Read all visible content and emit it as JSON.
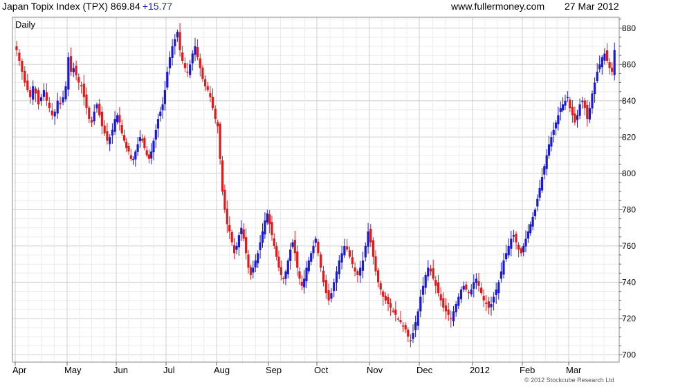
{
  "header": {
    "title": "Japan Topix Index (TPX) 869.84",
    "change": "+15.77",
    "site": "www.fullermoney.com",
    "date": "27 Mar 2012"
  },
  "footer": {
    "copyright": "© 2012 Stockcube Research Ltd"
  },
  "colors": {
    "up": "#1a1ad6",
    "down": "#e01a1a",
    "grid": "#d0d0d0",
    "label": "#1a1ad6"
  },
  "chart_data": {
    "type": "candlestick",
    "period_label": "Daily",
    "y_ticks": [
      700,
      720,
      740,
      760,
      780,
      800,
      820,
      840,
      860,
      880
    ],
    "x_tick_labels": [
      "Apr",
      "May",
      "Jun",
      "Jul",
      "Aug",
      "Sep",
      "Oct",
      "Nov",
      "Dec",
      "2012",
      "Feb",
      "Mar"
    ],
    "ylim": [
      696,
      886
    ],
    "grid": true,
    "y_axis_position": "right",
    "series": [
      {
        "segment": "Apr",
        "trading_days": 19,
        "approx_daily_close": [
          868,
          862,
          856,
          850,
          846,
          842,
          848,
          844,
          838,
          842,
          846,
          840,
          836,
          832,
          834,
          840,
          838,
          842,
          848
        ]
      },
      {
        "segment": "May",
        "trading_days": 19,
        "approx_daily_close": [
          864,
          856,
          858,
          854,
          850,
          848,
          842,
          836,
          830,
          828,
          834,
          838,
          832,
          826,
          822,
          818,
          820,
          824,
          830
        ]
      },
      {
        "segment": "Jun",
        "trading_days": 22,
        "approx_daily_close": [
          832,
          828,
          822,
          818,
          814,
          812,
          808,
          808,
          812,
          816,
          820,
          818,
          814,
          810,
          808,
          812,
          818,
          824,
          830,
          834,
          838,
          846
        ]
      },
      {
        "segment": "Jul",
        "trading_days": 20,
        "approx_daily_close": [
          856,
          864,
          870,
          874,
          878,
          868,
          862,
          858,
          856,
          860,
          866,
          870,
          864,
          858,
          852,
          848,
          846,
          842,
          836,
          830
        ]
      },
      {
        "segment": "Aug",
        "trading_days": 22,
        "approx_daily_close": [
          826,
          808,
          790,
          780,
          772,
          768,
          762,
          756,
          760,
          766,
          770,
          764,
          756,
          748,
          744,
          748,
          752,
          756,
          762,
          768,
          774,
          778
        ]
      },
      {
        "segment": "Sep",
        "trading_days": 21,
        "approx_daily_close": [
          772,
          766,
          760,
          754,
          748,
          744,
          742,
          746,
          752,
          758,
          762,
          756,
          748,
          742,
          738,
          742,
          748,
          752,
          756,
          760,
          764
        ]
      },
      {
        "segment": "Oct",
        "trading_days": 20,
        "approx_daily_close": [
          756,
          748,
          740,
          734,
          730,
          734,
          740,
          746,
          752,
          756,
          760,
          758,
          754,
          750,
          746,
          744,
          748,
          752,
          760,
          768
        ]
      },
      {
        "segment": "Nov",
        "trading_days": 20,
        "approx_daily_close": [
          762,
          754,
          746,
          740,
          736,
          732,
          730,
          728,
          726,
          724,
          722,
          720,
          718,
          716,
          714,
          710,
          708,
          712,
          718,
          724
        ]
      },
      {
        "segment": "Dec",
        "trading_days": 21,
        "approx_daily_close": [
          732,
          738,
          744,
          748,
          746,
          742,
          738,
          734,
          730,
          726,
          724,
          722,
          720,
          724,
          728,
          732,
          736,
          738,
          736,
          734,
          736
        ]
      },
      {
        "segment": "2012",
        "trading_days": 20,
        "approx_daily_close": [
          740,
          742,
          738,
          734,
          730,
          728,
          726,
          728,
          732,
          736,
          740,
          746,
          752,
          756,
          760,
          764,
          766,
          762,
          758,
          756
        ]
      },
      {
        "segment": "Feb",
        "trading_days": 20,
        "approx_daily_close": [
          760,
          764,
          768,
          772,
          776,
          780,
          786,
          792,
          798,
          804,
          810,
          816,
          820,
          824,
          828,
          832,
          836,
          838,
          840,
          842
        ]
      },
      {
        "segment": "Mar",
        "trading_days": 19,
        "approx_daily_close": [
          836,
          832,
          828,
          832,
          838,
          840,
          836,
          830,
          836,
          844,
          850,
          856,
          860,
          864,
          866,
          862,
          858,
          856,
          868
        ]
      }
    ]
  }
}
